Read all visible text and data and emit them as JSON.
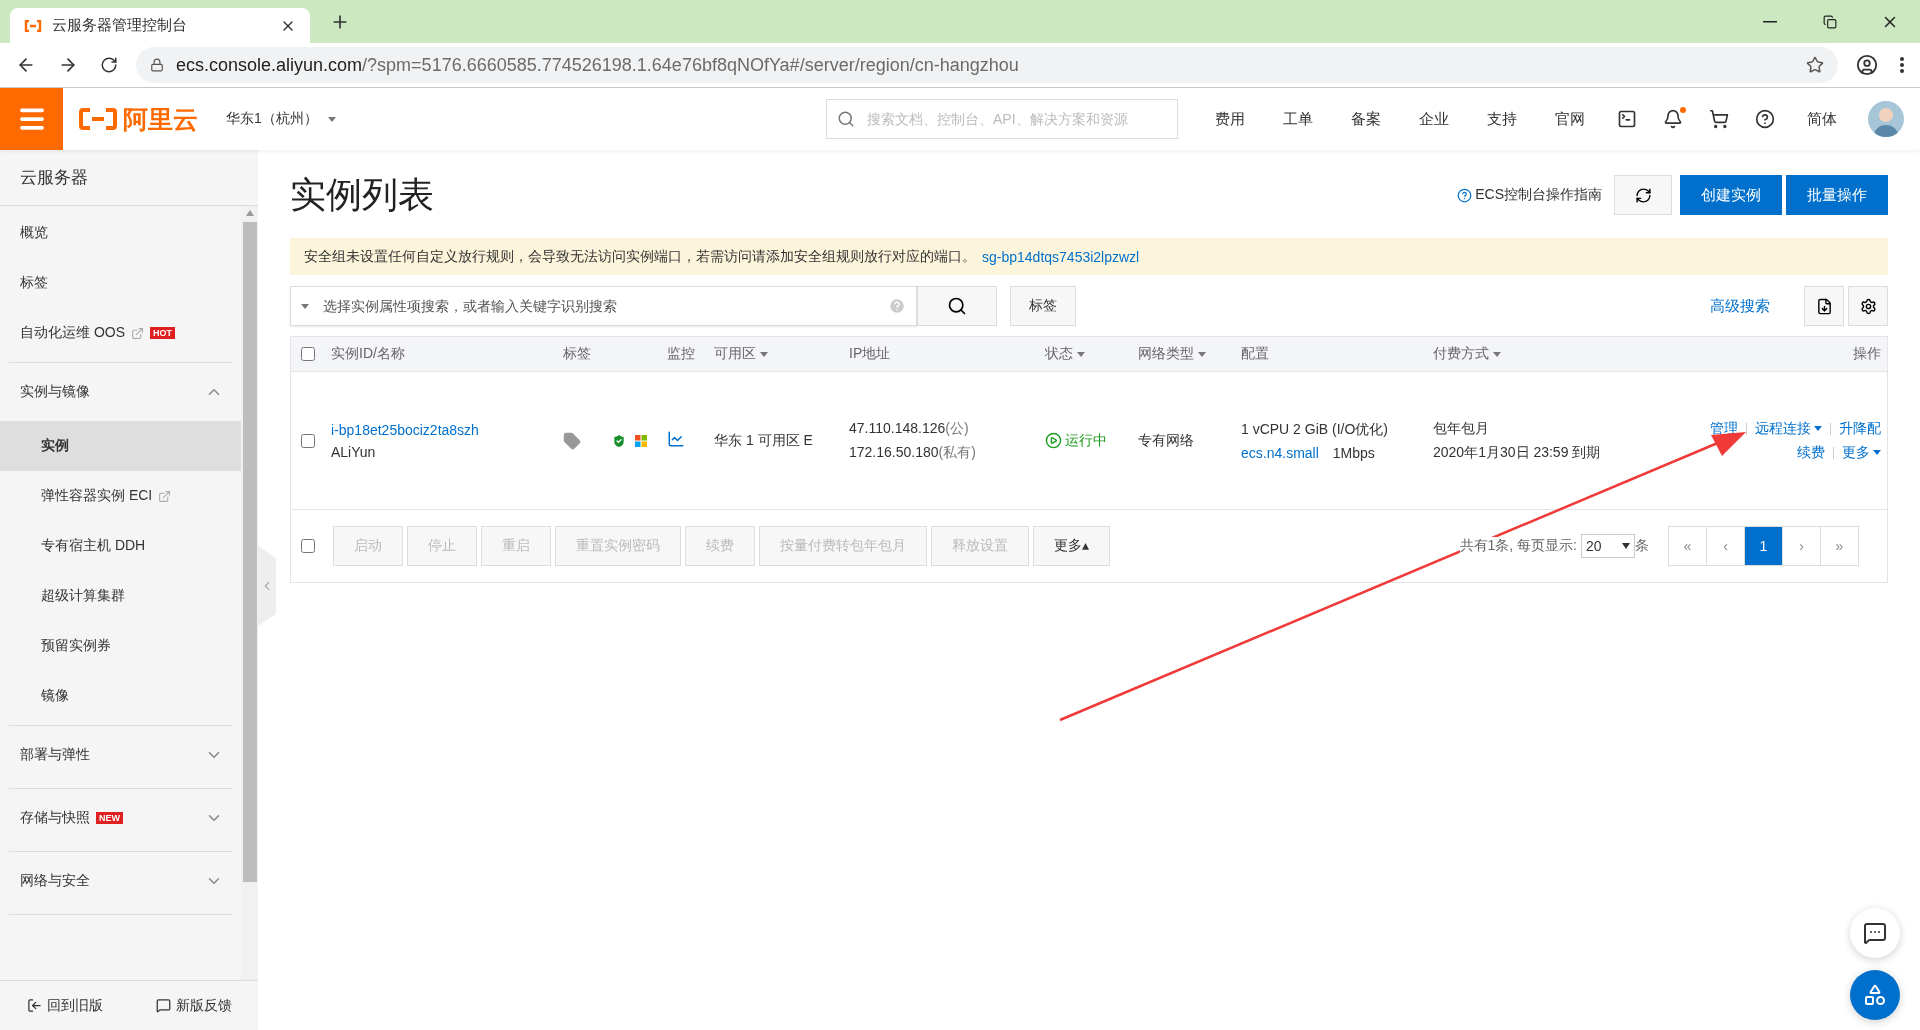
{
  "browser": {
    "tab_title": "云服务器管理控制台",
    "url_host": "ecs.console.aliyun.com",
    "url_rest": "/?spm=5176.6660585.774526198.1.64e76bf8qNOfYa#/server/region/cn-hangzhou"
  },
  "header": {
    "logo_text": "阿里云",
    "region": "华东1（杭州）",
    "search_placeholder": "搜索文档、控制台、API、解决方案和资源",
    "nav": [
      "费用",
      "工单",
      "备案",
      "企业",
      "支持",
      "官网"
    ],
    "notification_dot": true,
    "language": "简体"
  },
  "sidebar": {
    "title": "云服务器",
    "sections": [
      {
        "kind": "plain",
        "items": [
          {
            "label": "概览",
            "selected": false,
            "external": false
          },
          {
            "label": "标签",
            "selected": false,
            "external": false
          },
          {
            "label": "自动化运维 OOS",
            "selected": false,
            "external": true,
            "badge": "HOT"
          }
        ]
      },
      {
        "kind": "group",
        "label": "实例与镜像",
        "expanded": true,
        "items": [
          {
            "label": "实例",
            "selected": true,
            "external": false
          },
          {
            "label": "弹性容器实例 ECI",
            "selected": false,
            "external": true
          },
          {
            "label": "专有宿主机 DDH",
            "selected": false,
            "external": false
          },
          {
            "label": "超级计算集群",
            "selected": false,
            "external": false
          },
          {
            "label": "预留实例券",
            "selected": false,
            "external": false
          },
          {
            "label": "镜像",
            "selected": false,
            "external": false
          }
        ]
      },
      {
        "kind": "group",
        "label": "部署与弹性",
        "expanded": false
      },
      {
        "kind": "group",
        "label": "存储与快照",
        "expanded": false,
        "badge": "NEW"
      },
      {
        "kind": "group",
        "label": "网络与安全",
        "expanded": false
      }
    ],
    "footer": [
      "回到旧版",
      "新版反馈"
    ]
  },
  "page": {
    "title": "实例列表",
    "guide_link": "ECS控制台操作指南",
    "buttons": [
      "创建实例",
      "批量操作"
    ],
    "notice": {
      "text": "安全组未设置任何自定义放行规则，会导致无法访问实例端口，若需访问请添加安全组规则放行对应的端口。",
      "link": "sg-bp14dtqs7453i2lpzwzl"
    },
    "search": {
      "placeholder": "选择实例属性项搜索，或者输入关键字识别搜索",
      "tag_button": "标签",
      "advanced": "高级搜索"
    }
  },
  "table": {
    "select_all_checked": false,
    "columns": [
      {
        "label": "实例ID/名称",
        "sortable": false
      },
      {
        "label": "标签",
        "sortable": false
      },
      {
        "label": "监控",
        "sortable": false
      },
      {
        "label": "可用区",
        "sortable": true
      },
      {
        "label": "IP地址",
        "sortable": false
      },
      {
        "label": "状态",
        "sortable": true
      },
      {
        "label": "网络类型",
        "sortable": true
      },
      {
        "label": "配置",
        "sortable": false
      },
      {
        "label": "付费方式",
        "sortable": true
      },
      {
        "label": "操作",
        "sortable": false
      }
    ],
    "rows": [
      {
        "checked": false,
        "id": "i-bp18et25bociz2ta8szh",
        "name": "ALiYun",
        "zone": "华东 1 可用区 E",
        "public_ip": "47.110.148.126",
        "public_suffix": "(公)",
        "private_ip": "172.16.50.180",
        "private_suffix": "(私有)",
        "status": "运行中",
        "network": "专有网络",
        "spec": "1 vCPU 2 GiB (I/O优化)",
        "instance_type": "ecs.n4.small",
        "bandwidth": "1Mbps",
        "billing": "包年包月",
        "expiry": "2020年1月30日 23:59 到期",
        "actions": [
          [
            {
              "label": "管理",
              "dropdown": false
            },
            {
              "label": "远程连接",
              "dropdown": true
            },
            {
              "label": "升降配",
              "dropdown": false
            }
          ],
          [
            {
              "label": "续费",
              "dropdown": false
            },
            {
              "label": "更多",
              "dropdown": true
            }
          ]
        ]
      }
    ],
    "footer_checked": false,
    "bulk_actions": [
      {
        "label": "启动",
        "disabled": true
      },
      {
        "label": "停止",
        "disabled": true
      },
      {
        "label": "重启",
        "disabled": true
      },
      {
        "label": "重置实例密码",
        "disabled": true
      },
      {
        "label": "续费",
        "disabled": true
      },
      {
        "label": "按量付费转包年包月",
        "disabled": true
      },
      {
        "label": "释放设置",
        "disabled": true
      },
      {
        "label": "更多▴",
        "disabled": false
      }
    ],
    "pagination": {
      "total_text": "共有1条, 每页显示:",
      "page_size": "20",
      "unit": "条",
      "first": "«",
      "prev": "‹",
      "pages": [
        {
          "label": "1",
          "selected": true
        }
      ],
      "next": "›",
      "last": "»"
    }
  }
}
